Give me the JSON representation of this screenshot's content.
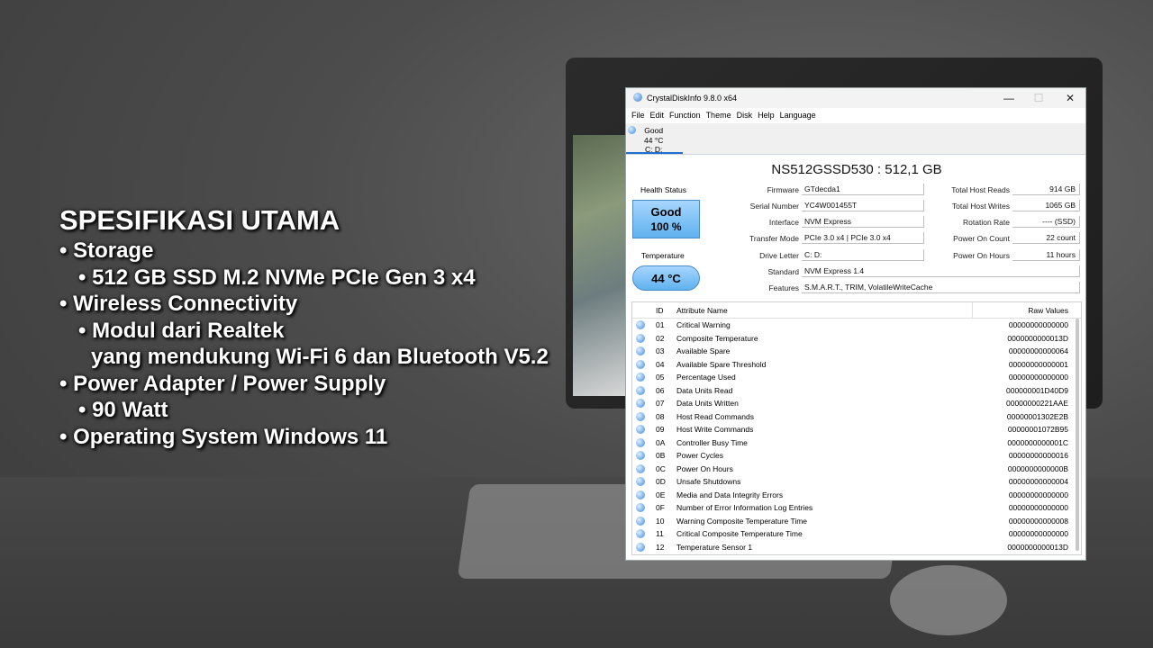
{
  "specs": {
    "title": "SPESIFIKASI UTAMA",
    "lines": [
      {
        "lvl": 1,
        "text": "• Storage"
      },
      {
        "lvl": 2,
        "text": "• 512 GB SSD M.2 NVMe PCIe Gen 3 x4"
      },
      {
        "lvl": 1,
        "text": "• Wireless Connectivity"
      },
      {
        "lvl": 2,
        "text": "• Modul dari Realtek"
      },
      {
        "lvl": 3,
        "text": "yang mendukung Wi-Fi 6 dan Bluetooth V5.2"
      },
      {
        "lvl": 1,
        "text": "• Power Adapter / Power Supply"
      },
      {
        "lvl": 2,
        "text": "• 90 Watt"
      },
      {
        "lvl": 1,
        "text": "• Operating System Windows 11"
      }
    ]
  },
  "window": {
    "title": "CrystalDiskInfo 9.8.0 x64",
    "controls": {
      "minimize": "—",
      "maximize": "☐",
      "close": "✕"
    },
    "menu": [
      "File",
      "Edit",
      "Function",
      "Theme",
      "Disk",
      "Help",
      "Language"
    ],
    "disk_tab": {
      "status": "Good",
      "temp": "44 °C",
      "letters": "C: D:"
    },
    "drive_title": "NS512GSSD530 : 512,1 GB",
    "health": {
      "label": "Health Status",
      "status": "Good",
      "percent": "100 %"
    },
    "temperature": {
      "label": "Temperature",
      "value": "44 °C"
    },
    "info": {
      "firmware": {
        "label": "Firmware",
        "value": "GTdecda1"
      },
      "serial": {
        "label": "Serial Number",
        "value": "YC4W001455T"
      },
      "interface": {
        "label": "Interface",
        "value": "NVM Express"
      },
      "transfer": {
        "label": "Transfer Mode",
        "value": "PCIe 3.0 x4 | PCIe 3.0 x4"
      },
      "drive_letter": {
        "label": "Drive Letter",
        "value": "C: D:"
      },
      "standard": {
        "label": "Standard",
        "value": "NVM Express 1.4"
      },
      "features": {
        "label": "Features",
        "value": "S.M.A.R.T., TRIM, VolatileWriteCache"
      }
    },
    "stats": {
      "reads": {
        "label": "Total Host Reads",
        "value": "914 GB"
      },
      "writes": {
        "label": "Total Host Writes",
        "value": "1065 GB"
      },
      "rotation": {
        "label": "Rotation Rate",
        "value": "---- (SSD)"
      },
      "power_count": {
        "label": "Power On Count",
        "value": "22 count"
      },
      "power_hours": {
        "label": "Power On Hours",
        "value": "11 hours"
      }
    },
    "attributes": {
      "headers": {
        "id": "ID",
        "name": "Attribute Name",
        "raw": "Raw Values"
      },
      "rows": [
        {
          "id": "01",
          "name": "Critical Warning",
          "raw": "00000000000000"
        },
        {
          "id": "02",
          "name": "Composite Temperature",
          "raw": "0000000000013D"
        },
        {
          "id": "03",
          "name": "Available Spare",
          "raw": "00000000000064"
        },
        {
          "id": "04",
          "name": "Available Spare Threshold",
          "raw": "00000000000001"
        },
        {
          "id": "05",
          "name": "Percentage Used",
          "raw": "00000000000000"
        },
        {
          "id": "06",
          "name": "Data Units Read",
          "raw": "000000001D40D9"
        },
        {
          "id": "07",
          "name": "Data Units Written",
          "raw": "00000000221AAE"
        },
        {
          "id": "08",
          "name": "Host Read Commands",
          "raw": "00000001302E2B"
        },
        {
          "id": "09",
          "name": "Host Write Commands",
          "raw": "00000001072B95"
        },
        {
          "id": "0A",
          "name": "Controller Busy Time",
          "raw": "0000000000001C"
        },
        {
          "id": "0B",
          "name": "Power Cycles",
          "raw": "00000000000016"
        },
        {
          "id": "0C",
          "name": "Power On Hours",
          "raw": "0000000000000B"
        },
        {
          "id": "0D",
          "name": "Unsafe Shutdowns",
          "raw": "00000000000004"
        },
        {
          "id": "0E",
          "name": "Media and Data Integrity Errors",
          "raw": "00000000000000"
        },
        {
          "id": "0F",
          "name": "Number of Error Information Log Entries",
          "raw": "00000000000000"
        },
        {
          "id": "10",
          "name": "Warning Composite Temperature Time",
          "raw": "00000000000008"
        },
        {
          "id": "11",
          "name": "Critical Composite Temperature Time",
          "raw": "00000000000000"
        },
        {
          "id": "12",
          "name": "Temperature Sensor 1",
          "raw": "0000000000013D"
        }
      ]
    }
  }
}
